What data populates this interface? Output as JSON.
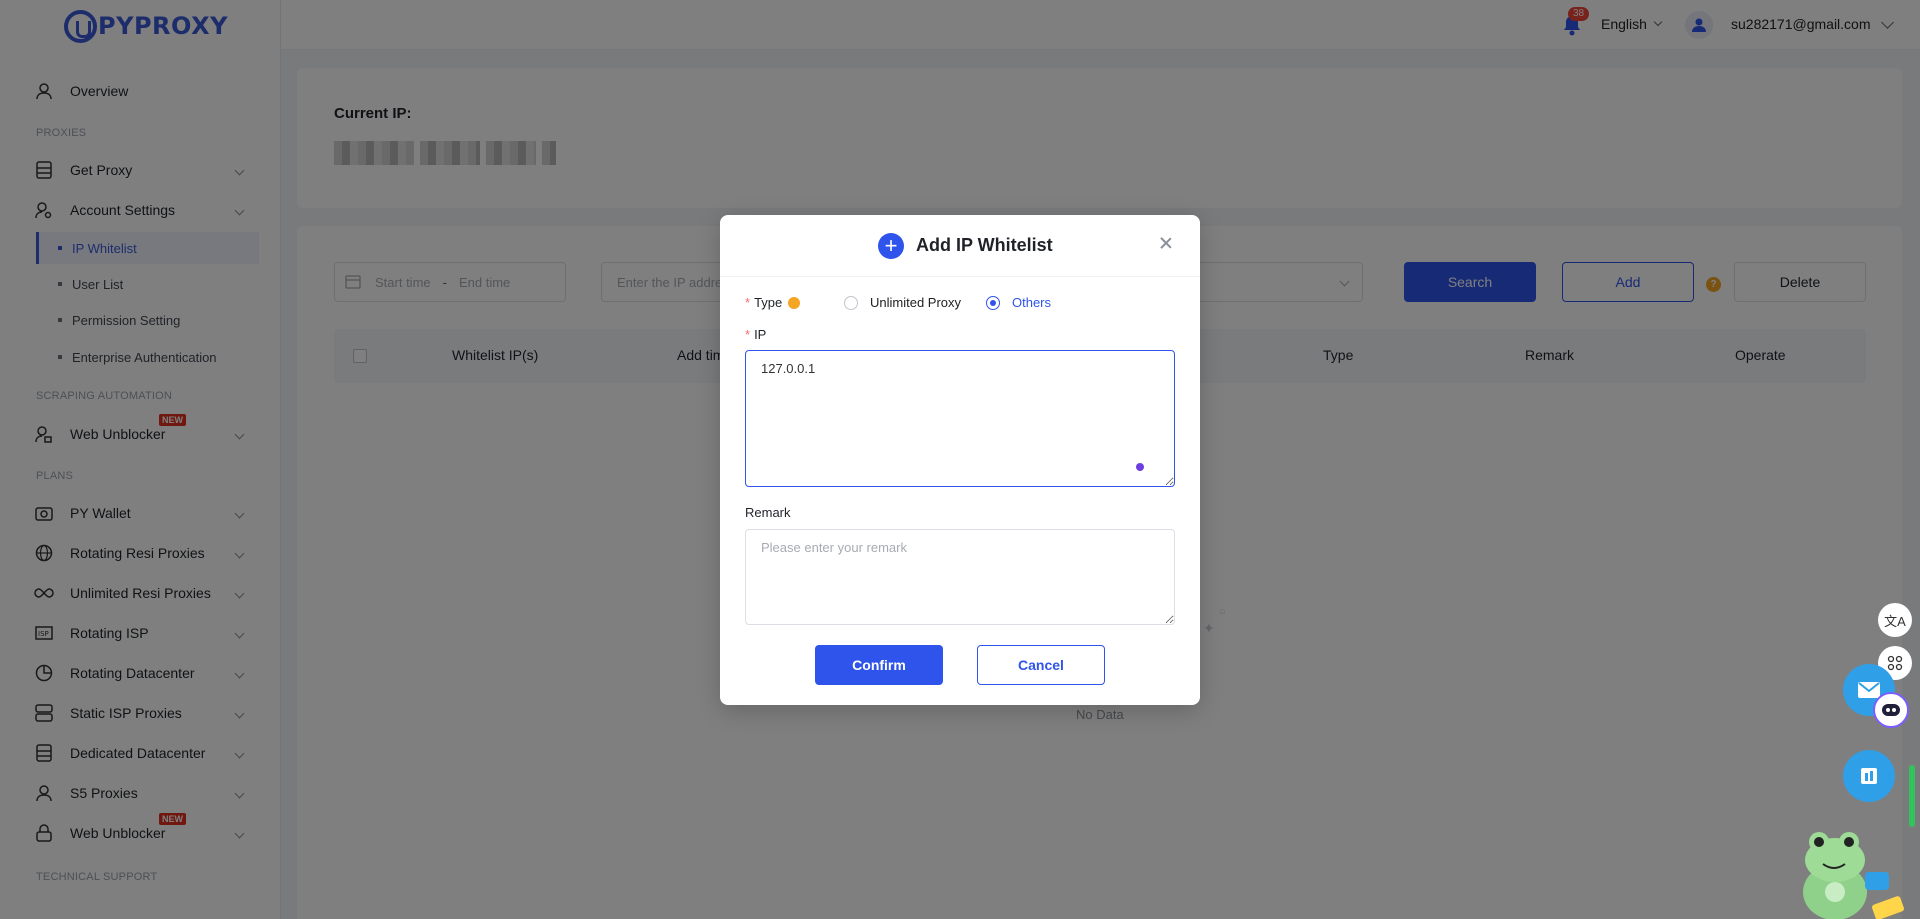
{
  "brand": {
    "logo_text": "PYPROXY",
    "accent": "#2f54eb"
  },
  "header": {
    "notifications": "38",
    "language": "English",
    "user_email": "su282171@gmail.com"
  },
  "sidebar": {
    "overview": "Overview",
    "sections": {
      "proxies": "PROXIES",
      "scraping": "SCRAPING AUTOMATION",
      "plans": "PLANS",
      "support": "TECHNICAL SUPPORT"
    },
    "get_proxy": "Get Proxy",
    "account_settings": "Account Settings",
    "sub_items": [
      "IP Whitelist",
      "User List",
      "Permission Setting",
      "Enterprise Authentication"
    ],
    "web_unblocker": "Web Unblocker",
    "new_badge": "NEW",
    "plans": [
      "PY Wallet",
      "Rotating Resi Proxies",
      "Unlimited Resi Proxies",
      "Rotating ISP",
      "Rotating Datacenter",
      "Static ISP Proxies",
      "Dedicated Datacenter",
      "S5 Proxies",
      "Web Unblocker"
    ]
  },
  "main": {
    "current_ip_label": "Current IP:",
    "filters": {
      "start_time": "Start time",
      "separator": "-",
      "end_time": "End time",
      "ip_placeholder": "Enter the IP address"
    },
    "buttons": {
      "search": "Search",
      "add": "Add",
      "delete": "Delete"
    },
    "table_headers": [
      "Whitelist IP(s)",
      "Add time",
      "Type",
      "Remark",
      "Operate"
    ],
    "no_data": "No Data"
  },
  "modal": {
    "title": "Add IP Whitelist",
    "type_label": "Type",
    "type_options": [
      "Unlimited Proxy",
      "Others"
    ],
    "type_selected": "Others",
    "ip_label": "IP",
    "ip_value": "127.0.0.1",
    "remark_label": "Remark",
    "remark_placeholder": "Please enter your remark",
    "confirm": "Confirm",
    "cancel": "Cancel",
    "required_mark": "*"
  },
  "widgets": {
    "translate_glyph": "文A"
  }
}
